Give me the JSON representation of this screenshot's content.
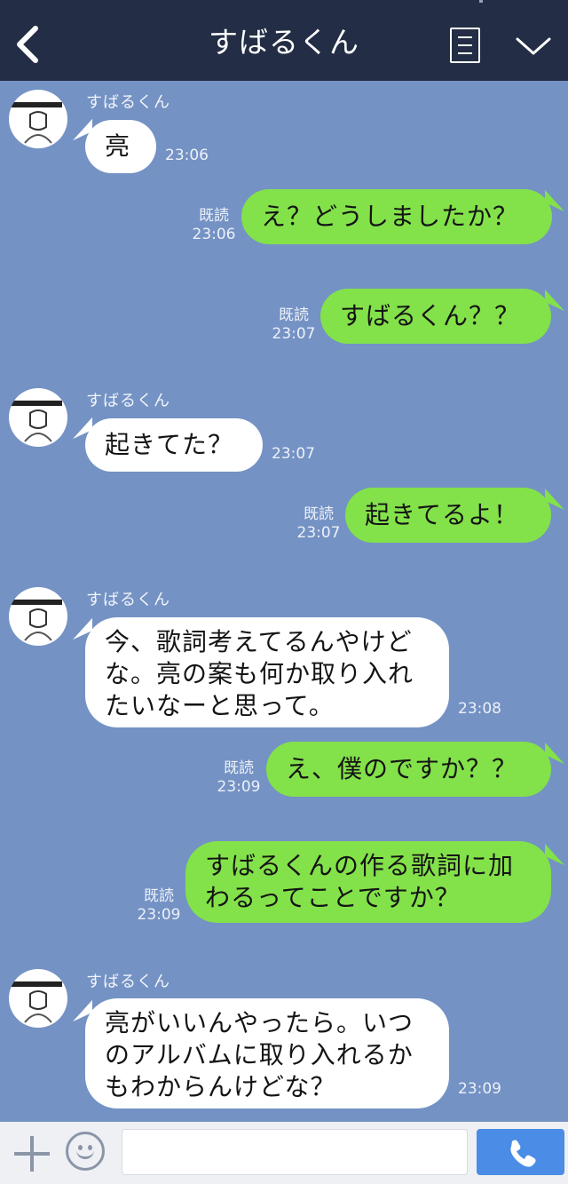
{
  "header": {
    "title": "すばるくん",
    "back_icon": "chevron-left-icon",
    "menu_icon": "document-menu-icon",
    "dropdown_icon": "chevron-down-icon"
  },
  "colors": {
    "header_bg": "#232d45",
    "chat_bg": "#7492c4",
    "outgoing_bubble": "#83e14a",
    "incoming_bubble": "#ffffff",
    "send_button": "#4a8ce6"
  },
  "messages": [
    {
      "direction": "in",
      "sender": "すばるくん",
      "lines": [
        "亮"
      ],
      "time": "23:06"
    },
    {
      "direction": "out",
      "lines": [
        "え？どうしましたか？"
      ],
      "read": "既読",
      "time": "23:06"
    },
    {
      "direction": "out",
      "lines": [
        "すばるくん？？"
      ],
      "read": "既読",
      "time": "23:07"
    },
    {
      "direction": "in",
      "sender": "すばるくん",
      "lines": [
        "起きてた？"
      ],
      "time": "23:07"
    },
    {
      "direction": "out",
      "lines": [
        "起きてるよ！"
      ],
      "read": "既読",
      "time": "23:07"
    },
    {
      "direction": "in",
      "sender": "すばるくん",
      "lines": [
        "今、歌詞考えてるんやけど",
        "な。亮の案も何か取り入れ",
        "たいなーと思って。"
      ],
      "time": "23:08"
    },
    {
      "direction": "out",
      "lines": [
        "え、僕のですか？？"
      ],
      "read": "既読",
      "time": "23:09"
    },
    {
      "direction": "out",
      "lines": [
        "すばるくんの作る歌詞に加",
        "わるってことですか？"
      ],
      "read": "既読",
      "time": "23:09"
    },
    {
      "direction": "in",
      "sender": "すばるくん",
      "lines": [
        "亮がいいんやったら。いつ",
        "のアルバムに取り入れるか",
        "もわからんけどな？"
      ],
      "time": "23:09"
    }
  ],
  "footer": {
    "input_value": "",
    "plus_icon": "plus-icon",
    "emoji_icon": "emoji-icon",
    "call_icon": "phone-icon"
  }
}
